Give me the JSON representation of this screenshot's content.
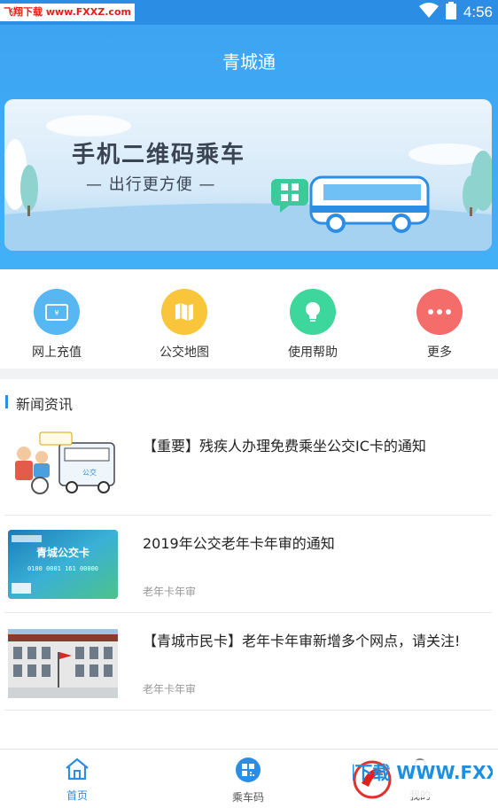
{
  "status_bar": {
    "watermark": "飞翔下载 www.FXXZ.com",
    "time": "4:56"
  },
  "header": {
    "title": "青城通"
  },
  "banner": {
    "title": "手机二维码乘车",
    "subtitle": "— 出行更方便 —"
  },
  "actions": [
    {
      "label": "网上充值",
      "icon": "wallet-icon",
      "color": "#56b7f2"
    },
    {
      "label": "公交地图",
      "icon": "map-icon",
      "color": "#f9c53b"
    },
    {
      "label": "使用帮助",
      "icon": "lightbulb-icon",
      "color": "#3dd69c"
    },
    {
      "label": "更多",
      "icon": "more-dots-icon",
      "color": "#f46d6b"
    }
  ],
  "news": {
    "section_title": "新闻资讯",
    "items": [
      {
        "title": "【重要】残疾人办理免费乘坐公交IC卡的通知",
        "tag": ""
      },
      {
        "title": "2019年公交老年卡年审的通知",
        "tag": "老年卡年审"
      },
      {
        "title": "【青城市民卡】老年卡年审新增多个网点，请关注!",
        "tag": "老年卡年审"
      }
    ],
    "thumb_texts": {
      "bus_sign": "公交",
      "card_name": "青城公交卡",
      "card_number": "0100 0001 161 00000"
    }
  },
  "bottom_nav": {
    "items": [
      {
        "label": "首页",
        "icon": "home-icon",
        "active": true
      },
      {
        "label": "乘车码",
        "icon": "qrcode-icon",
        "active": false
      },
      {
        "label": "我的",
        "icon": "user-icon",
        "active": false
      }
    ],
    "watermark": "飞翔下载 WWW.FXXZ.COM"
  },
  "colors": {
    "accent": "#2c8de4",
    "header_bg": "#3da4f2",
    "active_nav": "#2c8de4",
    "inactive_nav": "#555555"
  }
}
